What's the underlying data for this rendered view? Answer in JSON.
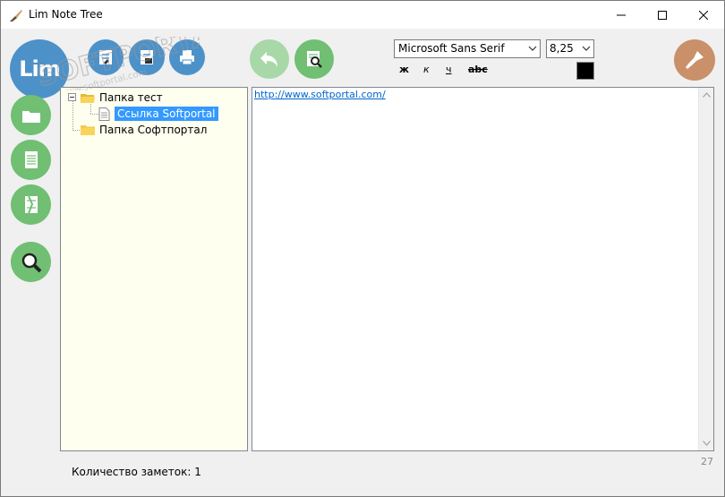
{
  "window": {
    "title": "Lim Note Tree"
  },
  "toolbar": {
    "logo_text": "Lim",
    "font_family_value": "Microsoft Sans Serif",
    "font_size_value": "8,25",
    "bold_label": "ж",
    "italic_label": "к",
    "underline_label": "ч",
    "strike_label": "abc",
    "text_color": "#000000"
  },
  "tree": {
    "items": [
      {
        "label": "Папка тест",
        "type": "folder",
        "expanded": true
      },
      {
        "label": "Ссылка Softportal",
        "type": "note",
        "selected": true
      },
      {
        "label": "Папка Софтпортал",
        "type": "folder",
        "expanded": false
      }
    ]
  },
  "editor": {
    "content": "http://www.softportal.com/"
  },
  "status": {
    "notes_count_text": "Количество заметок: 1",
    "char_count": "27"
  },
  "watermark": {
    "text": "SOFTPORTAL",
    "subtext": "www.softportal.com",
    "mark": "TM"
  },
  "colors": {
    "blue_button": "#4d91c9",
    "green_button": "#70bf73",
    "brush_button": "#c9906a",
    "tree_background": "#fffff0",
    "selection": "#3399ff"
  }
}
